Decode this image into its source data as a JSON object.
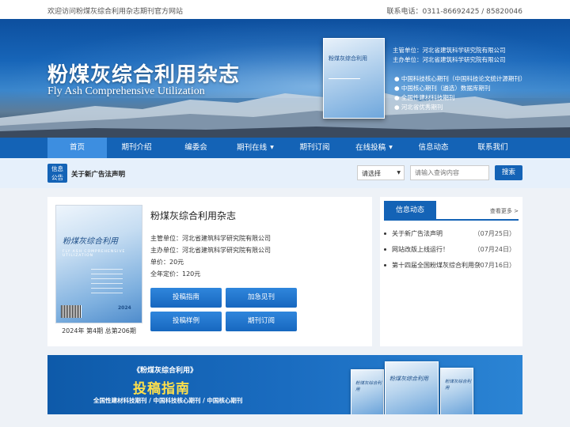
{
  "topbar": {
    "welcome": "欢迎访问粉煤灰综合利用杂志期刊官方网站",
    "phone": "联系电话：0311-86692425 / 85820046"
  },
  "banner": {
    "title_cn": "粉煤灰综合利用杂志",
    "title_en": "Fly Ash Comprehensive Utilization",
    "cover_title": "粉煤灰综合利用",
    "sponsor": "主管单位：河北省建筑科学研究院有限公司",
    "organizer": "主办单位：河北省建筑科学研究院有限公司",
    "bullets": [
      "● 中国科技核心期刊（中国科技论文统计源期刊）",
      "● 中国核心期刊（遴选）数据库期刊",
      "● 全国性建材科技期刊",
      "● 河北省优秀期刊"
    ]
  },
  "nav": {
    "items": [
      {
        "label": "首页"
      },
      {
        "label": "期刊介绍"
      },
      {
        "label": "编委会"
      },
      {
        "label": "期刊在线",
        "caret": "▼"
      },
      {
        "label": "期刊订阅"
      },
      {
        "label": "在线投稿",
        "caret": "▼"
      },
      {
        "label": "信息动态"
      },
      {
        "label": "联系我们"
      }
    ]
  },
  "notice": {
    "badge_line1": "信息",
    "badge_line2": "公告",
    "text": "关于新广告法声明",
    "select_value": "请选择",
    "search_placeholder": "请输入查询内容",
    "search_button": "搜索"
  },
  "journal": {
    "cover_title": "粉煤灰综合利用",
    "cover_en": "FLY ASH COMPREHENSIVE UTILIZATION",
    "cover_year": "2024",
    "issue": "2024年 第4期 总第206期",
    "title": "粉煤灰综合利用杂志",
    "lines": [
      "主管单位：河北省建筑科学研究院有限公司",
      "主办单位：河北省建筑科学研究院有限公司",
      "单价：20元",
      "全年定价：120元"
    ],
    "buttons": [
      "投稿指南",
      "加急见刊",
      "投稿样例",
      "期刊订阅"
    ]
  },
  "news": {
    "tab": "信息动态",
    "more": "查看更多 >",
    "items": [
      {
        "title": "关于新广告法声明",
        "date": "（07月25日）"
      },
      {
        "title": "网站改版上线运行！",
        "date": "（07月24日）"
      },
      {
        "title": "第十四届全国粉煤灰综合利用杂",
        "date": "（07月16日）"
      }
    ]
  },
  "promo": {
    "line1": "《粉煤灰综合利用》",
    "line2": "投稿指南",
    "line3": "全国性建材科技期刊 / 中国科技核心期刊 / 中国核心期刊",
    "cover_title": "粉煤灰综合利用"
  }
}
